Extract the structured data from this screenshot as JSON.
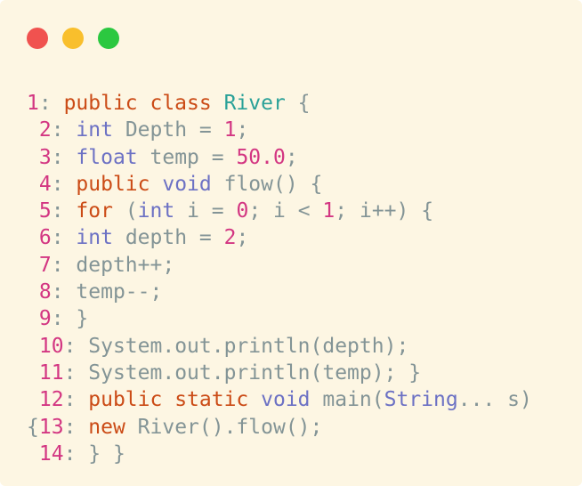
{
  "window": {
    "background": "#fdf6e3",
    "buttons": [
      {
        "name": "close",
        "color": "#f0524f"
      },
      {
        "name": "minimize",
        "color": "#f9bf2c"
      },
      {
        "name": "maximize",
        "color": "#2bc840"
      }
    ]
  },
  "colors": {
    "keyword": "#cb4b16",
    "type": "#6c71c4",
    "class": "#2aa198",
    "number": "#d33682",
    "plain": "#839496"
  },
  "code": {
    "lines": [
      {
        "num": "1",
        "tokens": [
          {
            "t": "public class ",
            "c": "kw-orange"
          },
          {
            "t": "River",
            "c": "cls"
          },
          {
            "t": " {",
            "c": "plain"
          }
        ]
      },
      {
        "num": "2",
        "tokens": [
          {
            "t": "int",
            "c": "kw-violet"
          },
          {
            "t": " Depth = ",
            "c": "plain"
          },
          {
            "t": "1",
            "c": "lit"
          },
          {
            "t": ";",
            "c": "plain"
          }
        ]
      },
      {
        "num": "3",
        "tokens": [
          {
            "t": "float",
            "c": "kw-violet"
          },
          {
            "t": " temp = ",
            "c": "plain"
          },
          {
            "t": "50.0",
            "c": "lit"
          },
          {
            "t": ";",
            "c": "plain"
          }
        ]
      },
      {
        "num": "4",
        "tokens": [
          {
            "t": "public ",
            "c": "kw-orange"
          },
          {
            "t": "void",
            "c": "kw-violet"
          },
          {
            "t": " flow() {",
            "c": "plain"
          }
        ]
      },
      {
        "num": "5",
        "tokens": [
          {
            "t": "for",
            "c": "kw-orange"
          },
          {
            "t": " (",
            "c": "plain"
          },
          {
            "t": "int",
            "c": "kw-violet"
          },
          {
            "t": " i = ",
            "c": "plain"
          },
          {
            "t": "0",
            "c": "lit"
          },
          {
            "t": "; i < ",
            "c": "plain"
          },
          {
            "t": "1",
            "c": "lit"
          },
          {
            "t": "; i++) {",
            "c": "plain"
          }
        ]
      },
      {
        "num": "6",
        "tokens": [
          {
            "t": "int",
            "c": "kw-violet"
          },
          {
            "t": " depth = ",
            "c": "plain"
          },
          {
            "t": "2",
            "c": "lit"
          },
          {
            "t": ";",
            "c": "plain"
          }
        ]
      },
      {
        "num": "7",
        "tokens": [
          {
            "t": "depth++;",
            "c": "plain"
          }
        ]
      },
      {
        "num": "8",
        "tokens": [
          {
            "t": "temp--;",
            "c": "plain"
          }
        ]
      },
      {
        "num": "9",
        "tokens": [
          {
            "t": "}",
            "c": "plain"
          }
        ]
      },
      {
        "num": "10",
        "tokens": [
          {
            "t": "System.out.println(depth);",
            "c": "plain"
          }
        ]
      },
      {
        "num": "11",
        "tokens": [
          {
            "t": "System.out.println(temp); }",
            "c": "plain"
          }
        ]
      },
      {
        "num": "12",
        "tokens": [
          {
            "t": "public static ",
            "c": "kw-orange"
          },
          {
            "t": "void",
            "c": "kw-violet"
          },
          {
            "t": " main(",
            "c": "plain"
          },
          {
            "t": "String",
            "c": "kw-violet"
          },
          {
            "t": "... s)",
            "c": "plain"
          }
        ]
      },
      {
        "num": "13",
        "prefix": "{",
        "tokens": [
          {
            "t": "new ",
            "c": "kw-orange"
          },
          {
            "t": "River().flow();",
            "c": "plain"
          }
        ]
      },
      {
        "num": "14",
        "tokens": [
          {
            "t": "} }",
            "c": "plain"
          }
        ]
      }
    ]
  }
}
